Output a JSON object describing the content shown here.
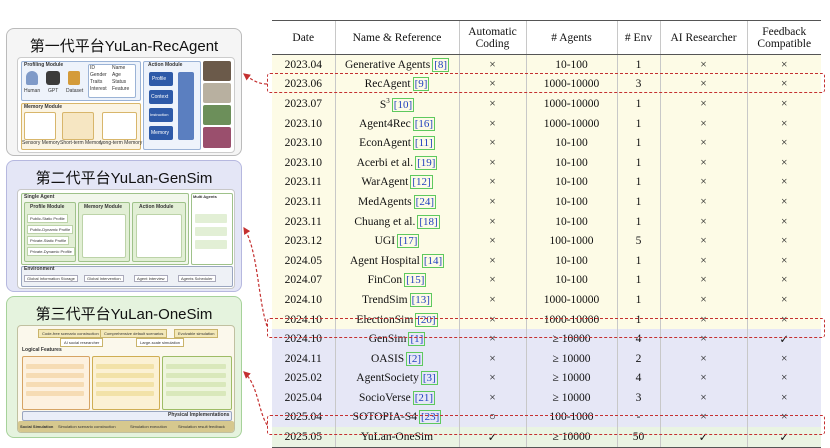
{
  "panels": [
    {
      "title": "第一代平台YuLan-RecAgent",
      "modules": {
        "profiling": "Profiling Module",
        "memory": "Memory Module",
        "action": "Action Module",
        "profile_fields": [
          "ID",
          "Name",
          "Gender",
          "Age",
          "Traits",
          "Status",
          "Interest",
          "Feature"
        ],
        "profile_sources": [
          "Human",
          "GPT",
          "Dataset"
        ],
        "memory_parts": [
          "Sensory Memory",
          "Short-term Memory",
          "Long-term Memory"
        ],
        "action_parts": [
          "Profile",
          "Context",
          "Instruction",
          "Memory"
        ]
      }
    },
    {
      "title": "第二代平台YuLan-GenSim",
      "modules": {
        "single_agent": "Single Agent",
        "multi_agents": "Multi Agents",
        "profile": "Profile Module",
        "memory": "Memory Module",
        "action": "Action Module",
        "environment": "Environment",
        "profile_items": [
          "Public-Static Profile",
          "Public-Dynamic Profile",
          "Private-Static Profile",
          "Private-Dynamic Profile"
        ],
        "env_items": [
          "Global Information Storage",
          "Global Intervention",
          "Agent Interview",
          "Agents Scheduler"
        ]
      }
    },
    {
      "title": "第三代平台YuLan-OneSim",
      "modules": {
        "top_items": [
          "Code-free scenario construction",
          "Comprehensive default scenarios",
          "Evolvable simulation"
        ],
        "sub_items": [
          "AI social researcher",
          "Large-scale simulation"
        ],
        "logical": "Logical Features",
        "physical": "Physical Implementations",
        "bottom": [
          "Social Simulation",
          "Simulation scenario construction",
          "Simulation execution",
          "Simulation result feedback"
        ]
      }
    }
  ],
  "table": {
    "headers": [
      "Date",
      "Name & Reference",
      "Automatic Coding",
      "# Agents",
      "# Env",
      "AI Researcher",
      "Feedback Compatible"
    ],
    "rows": [
      {
        "date": "2023.04",
        "name": "Generative Agents",
        "ref": "[8]",
        "coding": "×",
        "agents": "10-100",
        "env": "1",
        "ai": "×",
        "feedback": "×"
      },
      {
        "date": "2023.06",
        "name": "RecAgent",
        "ref": "[9]",
        "coding": "×",
        "agents": "1000-10000",
        "env": "3",
        "ai": "×",
        "feedback": "×"
      },
      {
        "date": "2023.07",
        "name": "S",
        "sup": "3",
        "ref": "[10]",
        "coding": "×",
        "agents": "1000-10000",
        "env": "1",
        "ai": "×",
        "feedback": "×"
      },
      {
        "date": "2023.10",
        "name": "Agent4Rec",
        "ref": "[16]",
        "coding": "×",
        "agents": "1000-10000",
        "env": "1",
        "ai": "×",
        "feedback": "×"
      },
      {
        "date": "2023.10",
        "name": "EconAgent",
        "ref": "[11]",
        "coding": "×",
        "agents": "10-100",
        "env": "1",
        "ai": "×",
        "feedback": "×"
      },
      {
        "date": "2023.10",
        "name": "Acerbi et al.",
        "ref": "[19]",
        "coding": "×",
        "agents": "10-100",
        "env": "1",
        "ai": "×",
        "feedback": "×"
      },
      {
        "date": "2023.11",
        "name": "WarAgent",
        "ref": "[12]",
        "coding": "×",
        "agents": "10-100",
        "env": "1",
        "ai": "×",
        "feedback": "×"
      },
      {
        "date": "2023.11",
        "name": "MedAgents",
        "ref": "[24]",
        "coding": "×",
        "agents": "10-100",
        "env": "1",
        "ai": "×",
        "feedback": "×"
      },
      {
        "date": "2023.11",
        "name": "Chuang et al.",
        "ref": "[18]",
        "coding": "×",
        "agents": "10-100",
        "env": "1",
        "ai": "×",
        "feedback": "×"
      },
      {
        "date": "2023.12",
        "name": "UGI",
        "ref": "[17]",
        "coding": "×",
        "agents": "100-1000",
        "env": "5",
        "ai": "×",
        "feedback": "×"
      },
      {
        "date": "2024.05",
        "name": "Agent Hospital",
        "ref": "[14]",
        "coding": "×",
        "agents": "10-100",
        "env": "1",
        "ai": "×",
        "feedback": "×"
      },
      {
        "date": "2024.07",
        "name": "FinCon",
        "ref": "[15]",
        "coding": "×",
        "agents": "10-100",
        "env": "1",
        "ai": "×",
        "feedback": "×"
      },
      {
        "date": "2024.10",
        "name": "TrendSim",
        "ref": "[13]",
        "coding": "×",
        "agents": "1000-10000",
        "env": "1",
        "ai": "×",
        "feedback": "×"
      },
      {
        "date": "2024.10",
        "name": "ElectionSim",
        "ref": "[20]",
        "coding": "×",
        "agents": "1000-10000",
        "env": "1",
        "ai": "×",
        "feedback": "×"
      },
      {
        "date": "2024.10",
        "name": "GenSim",
        "ref": "[1]",
        "coding": "×",
        "agents": "≥ 10000",
        "env": "4",
        "ai": "×",
        "feedback": "✓"
      },
      {
        "date": "2024.11",
        "name": "OASIS",
        "ref": "[2]",
        "coding": "×",
        "agents": "≥ 10000",
        "env": "2",
        "ai": "×",
        "feedback": "×"
      },
      {
        "date": "2025.02",
        "name": "AgentSociety",
        "ref": "[3]",
        "coding": "×",
        "agents": "≥ 10000",
        "env": "4",
        "ai": "×",
        "feedback": "×"
      },
      {
        "date": "2025.04",
        "name": "SocioVerse",
        "ref": "[21]",
        "coding": "×",
        "agents": "≥ 10000",
        "env": "3",
        "ai": "×",
        "feedback": "×"
      },
      {
        "date": "2025.04",
        "name": "SOTOPIA-S4",
        "ref": "[23]",
        "coding": "○",
        "agents": "100-1000",
        "env": "-",
        "ai": "×",
        "feedback": "×"
      },
      {
        "date": "2025.05",
        "name": "YuLan-OneSim",
        "ref": "",
        "coding": "✓",
        "agents": "≥ 10000",
        "env": "50",
        "ai": "✓",
        "feedback": "✓"
      }
    ]
  },
  "colors": {
    "yellow_rows": "#fdfbe6",
    "blue_rows": "#e6e7f6",
    "green_rows": "#eaf4e3",
    "highlight": "#c43030",
    "ref_border": "#5ec95e",
    "ref_text": "#1f3fbf"
  }
}
